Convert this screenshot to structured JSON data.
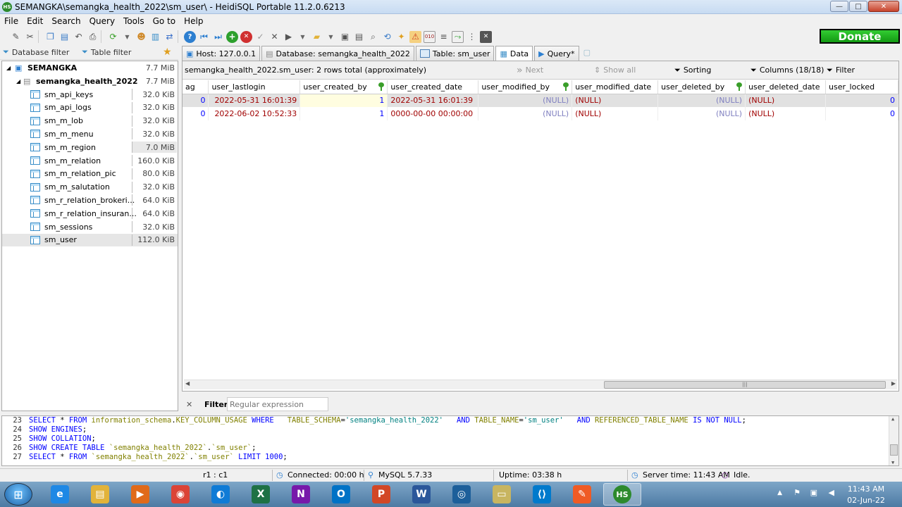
{
  "window": {
    "title": "SEMANGKA\\semangka_health_2022\\sm_user\\ - HeidiSQL Portable 11.2.0.6213",
    "app_icon_text": "HS",
    "minimize": "—",
    "maximize": "□",
    "close": "✕"
  },
  "menu": [
    "File",
    "Edit",
    "Search",
    "Query",
    "Tools",
    "Go to",
    "Help"
  ],
  "toolbar": {
    "donate_label": "Donate"
  },
  "left": {
    "database_filter": "Database filter",
    "table_filter": "Table filter",
    "server": {
      "name": "SEMANGKA",
      "size": "7.7 MiB"
    },
    "database": {
      "name": "semangka_health_2022",
      "size": "7.7 MiB"
    },
    "tables": [
      {
        "name": "sm_api_keys",
        "size": "32.0 KiB",
        "bar": 0.0
      },
      {
        "name": "sm_api_logs",
        "size": "32.0 KiB",
        "bar": 0.0
      },
      {
        "name": "sm_m_lob",
        "size": "32.0 KiB",
        "bar": 0.0
      },
      {
        "name": "sm_m_menu",
        "size": "32.0 KiB",
        "bar": 0.0
      },
      {
        "name": "sm_m_region",
        "size": "7.0 MiB",
        "bar": 1.0
      },
      {
        "name": "sm_m_relation",
        "size": "160.0 KiB",
        "bar": 0.02
      },
      {
        "name": "sm_m_relation_pic",
        "size": "80.0 KiB",
        "bar": 0.01
      },
      {
        "name": "sm_m_salutation",
        "size": "32.0 KiB",
        "bar": 0.0
      },
      {
        "name": "sm_r_relation_brokeri...",
        "size": "64.0 KiB",
        "bar": 0.01
      },
      {
        "name": "sm_r_relation_insuran...",
        "size": "64.0 KiB",
        "bar": 0.01
      },
      {
        "name": "sm_sessions",
        "size": "32.0 KiB",
        "bar": 0.0
      },
      {
        "name": "sm_user",
        "size": "112.0 KiB",
        "bar": 0.02
      }
    ]
  },
  "tabs": [
    {
      "label": "Host: 127.0.0.1"
    },
    {
      "label": "Database: semangka_health_2022"
    },
    {
      "label": "Table: sm_user"
    },
    {
      "label": "Data"
    },
    {
      "label": "Query*"
    }
  ],
  "data": {
    "info": "semangka_health_2022.sm_user: 2 rows total (approximately)",
    "next": "Next",
    "show_all": "Show all",
    "sorting": "Sorting",
    "columns": "Columns (18/18)",
    "filter": "Filter",
    "headers": [
      "ag",
      "user_lastlogin",
      "user_created_by",
      "user_created_date",
      "user_modified_by",
      "user_modified_date",
      "user_deleted_by",
      "user_deleted_date",
      "user_locked"
    ],
    "rows": [
      [
        "0",
        "2022-05-31 16:01:39",
        "1",
        "2022-05-31 16:01:39",
        "(NULL)",
        "(NULL)",
        "(NULL)",
        "(NULL)",
        "0"
      ],
      [
        "0",
        "2022-06-02 10:52:33",
        "1",
        "0000-00-00 00:00:00",
        "(NULL)",
        "(NULL)",
        "(NULL)",
        "(NULL)",
        "0"
      ]
    ],
    "scroll_grip": "|||"
  },
  "filterbar": {
    "close": "✕",
    "label": "Filter:",
    "placeholder": "Regular expression"
  },
  "sql_log": [
    {
      "ln": "23",
      "text": "SELECT * FROM information_schema.KEY_COLUMN_USAGE WHERE   TABLE_SCHEMA='semangka_health_2022'   AND TABLE_NAME='sm_user'   AND REFERENCED_TABLE_NAME IS NOT NULL;"
    },
    {
      "ln": "24",
      "text": "SHOW ENGINES;"
    },
    {
      "ln": "25",
      "text": "SHOW COLLATION;"
    },
    {
      "ln": "26",
      "text": "SHOW CREATE TABLE `semangka_health_2022`.`sm_user`;"
    },
    {
      "ln": "27",
      "text": "SELECT * FROM `semangka_health_2022`.`sm_user` LIMIT 1000;"
    }
  ],
  "status": {
    "cursor": "r1 : c1",
    "connected": "Connected: 00:00 h",
    "server": "MySQL 5.7.33",
    "uptime": "Uptime: 03:38 h",
    "server_time": "Server time: 11:43 AM",
    "state": "Idle."
  },
  "taskbar": {
    "time": "11:43 AM",
    "date": "02-Jun-22",
    "apps": [
      {
        "name": "ie",
        "glyph": "e",
        "color": "#1e88e5"
      },
      {
        "name": "explorer",
        "glyph": "▤",
        "color": "#e2b33a"
      },
      {
        "name": "media-player",
        "glyph": "▶",
        "color": "#e06a1a"
      },
      {
        "name": "chrome",
        "glyph": "◉",
        "color": "#db4437"
      },
      {
        "name": "edge",
        "glyph": "◐",
        "color": "#0f7bd6"
      },
      {
        "name": "excel",
        "glyph": "X",
        "color": "#1e7145"
      },
      {
        "name": "onenote",
        "glyph": "N",
        "color": "#7719aa"
      },
      {
        "name": "outlook",
        "glyph": "O",
        "color": "#0072c6"
      },
      {
        "name": "powerpoint",
        "glyph": "P",
        "color": "#d24726"
      },
      {
        "name": "word",
        "glyph": "W",
        "color": "#2b579a"
      },
      {
        "name": "swirl",
        "glyph": "◎",
        "color": "#1d5f9a"
      },
      {
        "name": "folder-app",
        "glyph": "▭",
        "color": "#c8b560"
      },
      {
        "name": "vscode",
        "glyph": "⟨⟩",
        "color": "#007acc"
      },
      {
        "name": "postman",
        "glyph": "✎",
        "color": "#ef5b25"
      },
      {
        "name": "heidisql",
        "glyph": "HS",
        "color": "#2d8a2d"
      }
    ]
  },
  "colors": {
    "accent": "#0000ff",
    "date": "#a00000",
    "null": "#8080c0",
    "donate": "#22b322"
  }
}
